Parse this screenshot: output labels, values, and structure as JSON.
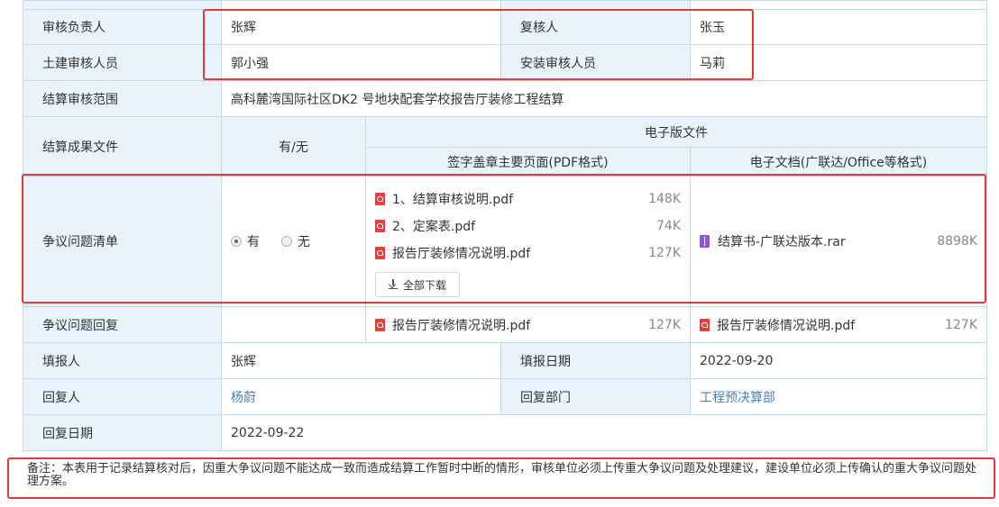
{
  "rows": {
    "reviewer_label": "审核负责人",
    "reviewer_value": "张辉",
    "checker_label": "复核人",
    "checker_value": "张玉",
    "civil_label": "土建审核人员",
    "civil_value": "郭小强",
    "install_label": "安装审核人员",
    "install_value": "马莉",
    "scope_label": "结算审核范围",
    "scope_value": "高科麓湾国际社区DK2 号地块配套学校报告厅装修工程结算"
  },
  "result_files": {
    "label": "结算成果文件",
    "has_label": "有/无",
    "electronic_header": "电子版文件",
    "pdf_header": "签字盖章主要页面(PDF格式)",
    "doc_header": "电子文档(广联达/Office等格式)"
  },
  "dispute": {
    "label": "争议问题清单",
    "options": [
      "有",
      "无"
    ],
    "selected": "有",
    "pdf_files": [
      {
        "name": "1、结算审核说明.pdf",
        "size": "148K"
      },
      {
        "name": "2、定案表.pdf",
        "size": "74K"
      },
      {
        "name": "报告厅装修情况说明.pdf",
        "size": "127K"
      }
    ],
    "download_all": "全部下载",
    "doc_file": {
      "name": "结算书-广联达版本.rar",
      "size": "8898K"
    }
  },
  "reply": {
    "label": "争议问题回复",
    "pdf_file": {
      "name": "报告厅装修情况说明.pdf",
      "size": "127K"
    },
    "doc_file": {
      "name": "报告厅装修情况说明.pdf",
      "size": "127K"
    }
  },
  "filler": {
    "label": "填报人",
    "value": "张辉",
    "date_label": "填报日期",
    "date_value": "2022-09-20"
  },
  "responder": {
    "label": "回复人",
    "value": "杨蔚",
    "dept_label": "回复部门",
    "dept_value": "工程预决算部"
  },
  "reply_date": {
    "label": "回复日期",
    "value": "2022-09-22"
  },
  "note": "备注：本表用于记录结算核对后，因重大争议问题不能达成一致而造成结算工作暂时中断的情形，审核单位必须上传重大争议问题及处理建议，建设单位必须上传确认的重大争议问题处理方案。",
  "colors": {
    "highlight": "#e53935",
    "label_bg": "#e9f3fc",
    "border": "#c3d9ea",
    "link": "#4a7fc1"
  },
  "icons": {
    "pdf": "pdf-file-icon",
    "rar": "rar-archive-icon",
    "download": "download-icon"
  }
}
